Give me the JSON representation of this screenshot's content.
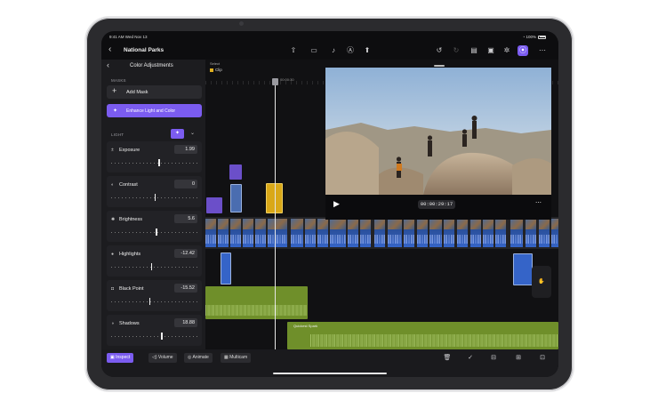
{
  "status": {
    "time": "9:41 AM",
    "date": "Wed Nov 13",
    "battery": "100%"
  },
  "header": {
    "project_title": "National Parks",
    "back_icon": "chevron-left-icon",
    "toolbar_icons": [
      "share-icon",
      "camera-icon",
      "microphone-icon",
      "navigator-icon",
      "export-icon",
      "undo-icon",
      "redo-icon",
      "titles-icon",
      "photos-icon",
      "effects-icon",
      "inspector-icon",
      "more-icon"
    ]
  },
  "panel": {
    "title": "Color Adjustments",
    "masks_label": "MASKS",
    "add_mask_label": "Add Mask",
    "enhance_label": "Enhance Light and Color",
    "light_label": "LIGHT",
    "sliders": [
      {
        "name": "Exposure",
        "icon": "exposure-icon",
        "value": "1.99",
        "position": 0.55
      },
      {
        "name": "Contrast",
        "icon": "contrast-icon",
        "value": "0",
        "position": 0.5
      },
      {
        "name": "Brightness",
        "icon": "brightness-icon",
        "value": "5.6",
        "position": 0.52
      },
      {
        "name": "Highlights",
        "icon": "highlights-icon",
        "value": "-12.42",
        "position": 0.46
      },
      {
        "name": "Black Point",
        "icon": "black-point-icon",
        "value": "-15.52",
        "position": 0.44
      },
      {
        "name": "Shadows",
        "icon": "shadows-icon",
        "value": "18.88",
        "position": 0.58
      }
    ]
  },
  "timeline": {
    "select_label": "Select",
    "clip_label": "Clip",
    "time_label": "00:00:30",
    "music_title": "Quickest Spark"
  },
  "viewer": {
    "timecode": "00:00:29:17"
  },
  "footer": {
    "inspect_label": "Inspect",
    "volume_label": "Volume",
    "animate_label": "Animate",
    "multicam_label": "Multicam"
  },
  "colors": {
    "accent": "#7b5cf0",
    "clip_blue": "#3564c8",
    "audio_green": "#6f8f2a"
  }
}
